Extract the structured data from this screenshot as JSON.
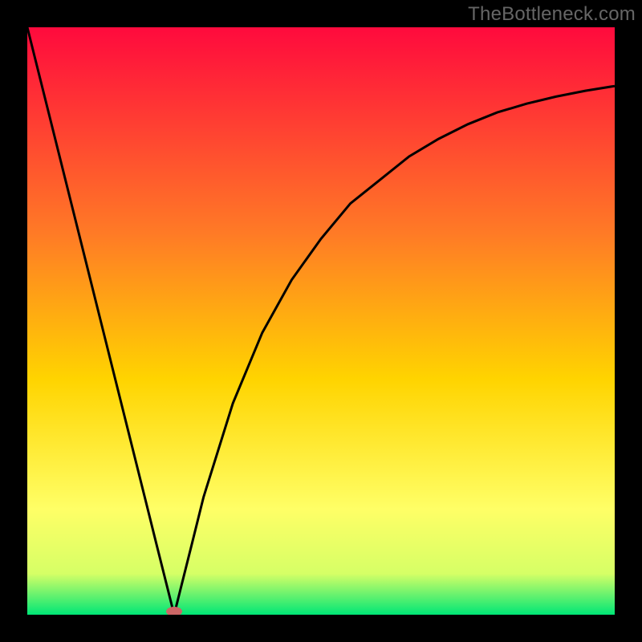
{
  "watermark": "TheBottleneck.com",
  "chart_data": {
    "type": "line",
    "title": "",
    "xlabel": "",
    "ylabel": "",
    "xlim": [
      0,
      100
    ],
    "ylim": [
      0,
      100
    ],
    "grid": false,
    "series": [
      {
        "name": "curve",
        "x": [
          0,
          5,
          10,
          15,
          20,
          22,
          24,
          25,
          26,
          28,
          30,
          35,
          40,
          45,
          50,
          55,
          60,
          65,
          70,
          75,
          80,
          85,
          90,
          95,
          100
        ],
        "values": [
          100,
          80,
          60,
          40,
          20,
          12,
          4,
          0,
          4,
          12,
          20,
          36,
          48,
          57,
          64,
          70,
          74,
          78,
          81,
          83.5,
          85.5,
          87,
          88.2,
          89.2,
          90
        ]
      }
    ],
    "marker": {
      "x": 25,
      "y": 0,
      "color": "#cc6666"
    },
    "gradient_stops": [
      {
        "pct": 0,
        "color": "#ff0a3d"
      },
      {
        "pct": 35,
        "color": "#ff7a26"
      },
      {
        "pct": 60,
        "color": "#ffd400"
      },
      {
        "pct": 82,
        "color": "#ffff66"
      },
      {
        "pct": 93,
        "color": "#d6ff66"
      },
      {
        "pct": 100,
        "color": "#00e676"
      }
    ]
  }
}
